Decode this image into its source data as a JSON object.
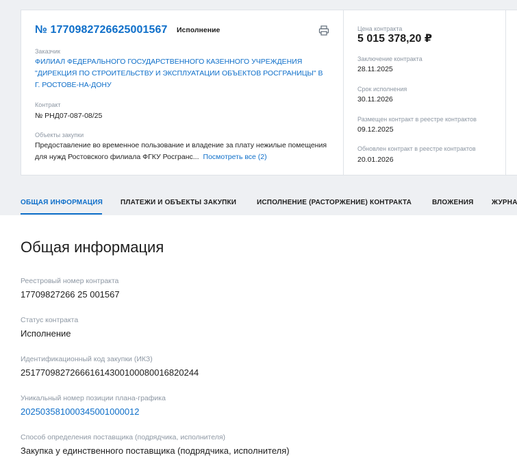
{
  "contract": {
    "number": "№ 1770982726625001567",
    "status_tag": "Исполнение",
    "customer_label": "Заказчик",
    "customer_name": "ФИЛИАЛ ФЕДЕРАЛЬНОГО ГОСУДАРСТВЕННОГО КАЗЕННОГО УЧРЕЖДЕНИЯ \"ДИРЕКЦИЯ ПО СТРОИТЕЛЬСТВУ И ЭКСПЛУАТАЦИИ ОБЪЕКТОВ РОСГРАНИЦЫ\" В Г. РОСТОВЕ-НА-ДОНУ",
    "contract_label": "Контракт",
    "contract_value": "№ РНД07-087-08/25",
    "objects_label": "Объекты закупки",
    "objects_text": "Предоставление во временное пользование и владение за плату нежилые помещения для нужд Ростовского филиала ФГКУ Росгранс...",
    "objects_more": "Посмотреть все (2)",
    "print_icon": "printer-icon"
  },
  "side": {
    "price_label": "Цена контракта",
    "price_value": "5 015 378,20 ₽",
    "conclusion_label": "Заключение контракта",
    "conclusion_value": "28.11.2025",
    "term_label": "Срок исполнения",
    "term_value": "30.11.2026",
    "placed_label": "Размещен контракт в реестре контрактов",
    "placed_value": "09.12.2025",
    "updated_label": "Обновлен контракт в реестре контрактов",
    "updated_value": "20.01.2026"
  },
  "tabs": [
    {
      "label": "ОБЩАЯ ИНФОРМАЦИЯ",
      "active": true
    },
    {
      "label": "ПЛАТЕЖИ И ОБЪЕКТЫ ЗАКУПКИ",
      "active": false
    },
    {
      "label": "ИСПОЛНЕНИЕ (РАСТОРЖЕНИЕ) КОНТРАКТА",
      "active": false
    },
    {
      "label": "ВЛОЖЕНИЯ",
      "active": false
    },
    {
      "label": "ЖУРНА",
      "active": false
    }
  ],
  "main": {
    "title": "Общая информация",
    "fields": [
      {
        "label": "Реестровый номер контракта",
        "value": "17709827266 25 001567"
      },
      {
        "label": "Статус контракта",
        "value": "Исполнение"
      },
      {
        "label": "Идентификационный код закупки (ИКЗ)",
        "value": "251770982726661614300100080016820244"
      },
      {
        "label": "Уникальный номер позиции плана-графика",
        "value": "202503581000345001000012"
      },
      {
        "label": "Способ определения поставщика (подрядчика, исполнителя)",
        "value": "Закупка у единственного поставщика (подрядчика, исполнителя)"
      }
    ]
  },
  "colors": {
    "accent": "#0d6ec9",
    "muted": "#8d97a3",
    "text": "#1e1e1e",
    "background": "#eef0f3"
  }
}
